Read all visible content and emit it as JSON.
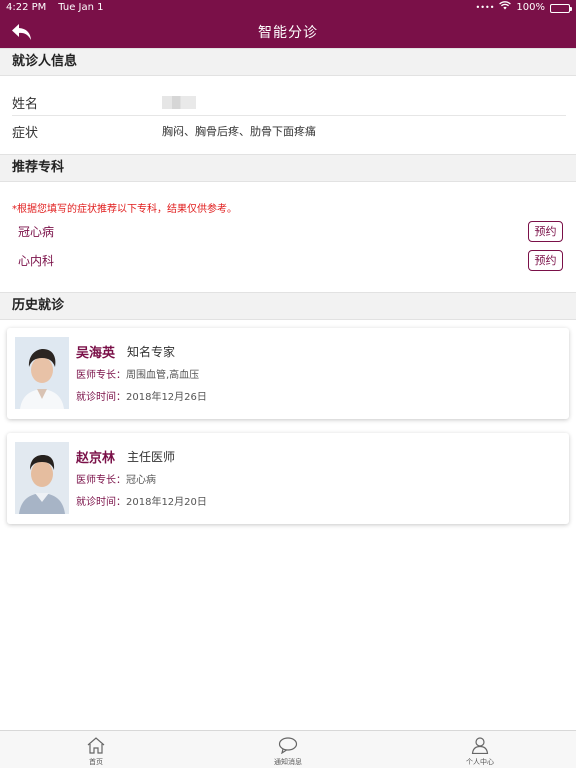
{
  "status": {
    "time": "4:22 PM",
    "date": "Tue Jan 1",
    "battery": "100%"
  },
  "nav": {
    "title": "智能分诊",
    "back_icon": "back-arrow-icon"
  },
  "patient_section": {
    "header": "就诊人信息",
    "rows": [
      {
        "label": "姓名",
        "value": ""
      },
      {
        "label": "症状",
        "value": "胸闷、胸骨后疼、肋骨下面疼痛"
      }
    ]
  },
  "recommend_section": {
    "header": "推荐专科",
    "notice": "*根据您填写的症状推荐以下专科，结果仅供参考。",
    "items": [
      {
        "name": "冠心病",
        "action": "预约"
      },
      {
        "name": "心内科",
        "action": "预约"
      }
    ]
  },
  "history_section": {
    "header": "历史就诊",
    "records": [
      {
        "name": "吴海英",
        "title": "知名专家",
        "specialty_label": "医师专长：",
        "specialty": "周围血管,高血压",
        "visit_label": "就诊时间：",
        "visit_date": "2018年12月26日"
      },
      {
        "name": "赵京林",
        "title": "主任医师",
        "specialty_label": "医师专长：",
        "specialty": "冠心病",
        "visit_label": "就诊时间：",
        "visit_date": "2018年12月20日"
      }
    ]
  },
  "tabbar": {
    "items": [
      {
        "label": "首页",
        "icon": "home-icon"
      },
      {
        "label": "通知消息",
        "icon": "chat-bubble-icon"
      },
      {
        "label": "个人中心",
        "icon": "person-icon"
      }
    ]
  },
  "colors": {
    "brand": "#7a1048",
    "notice": "#e01b1b",
    "section_bg": "#f2f2f2"
  }
}
